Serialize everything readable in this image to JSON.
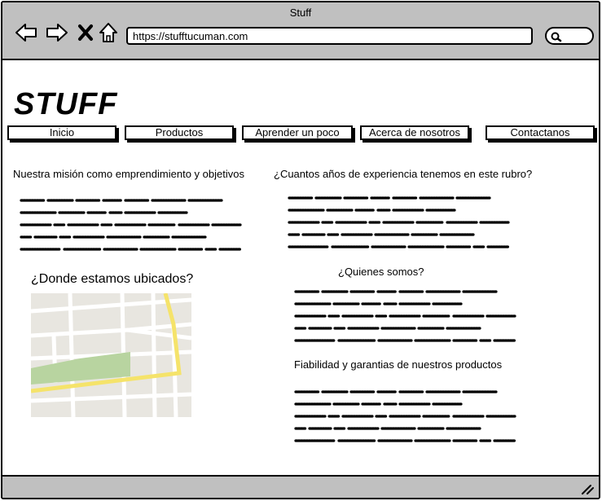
{
  "window": {
    "title": "Stuff",
    "url": "https://stufftucuman.com"
  },
  "icons": {
    "back": "arrow-left-icon",
    "forward": "arrow-right-icon",
    "stop": "close-icon",
    "home": "home-icon",
    "search": "search-icon",
    "resize": "resize-grip-icon"
  },
  "site": {
    "logo": "STUFF",
    "nav": [
      "Inicio",
      "Productos",
      "Aprender un poco",
      "Acerca de nosotros",
      "Contactanos"
    ]
  },
  "sections": {
    "mission": "Nuestra misión como emprendimiento y objetivos",
    "location": "¿Donde estamos ubicados?",
    "experience": "¿Cuantos años de experiencia tenemos en este rubro?",
    "about": "¿Quienes somos?",
    "reliability": "Fiabilidad y garantias de nuestros productos"
  },
  "colors": {
    "chrome": "#c0c0c0",
    "map_road": "#f5e36a",
    "map_park": "#b8d4a0",
    "map_bg": "#e8e6e0"
  }
}
